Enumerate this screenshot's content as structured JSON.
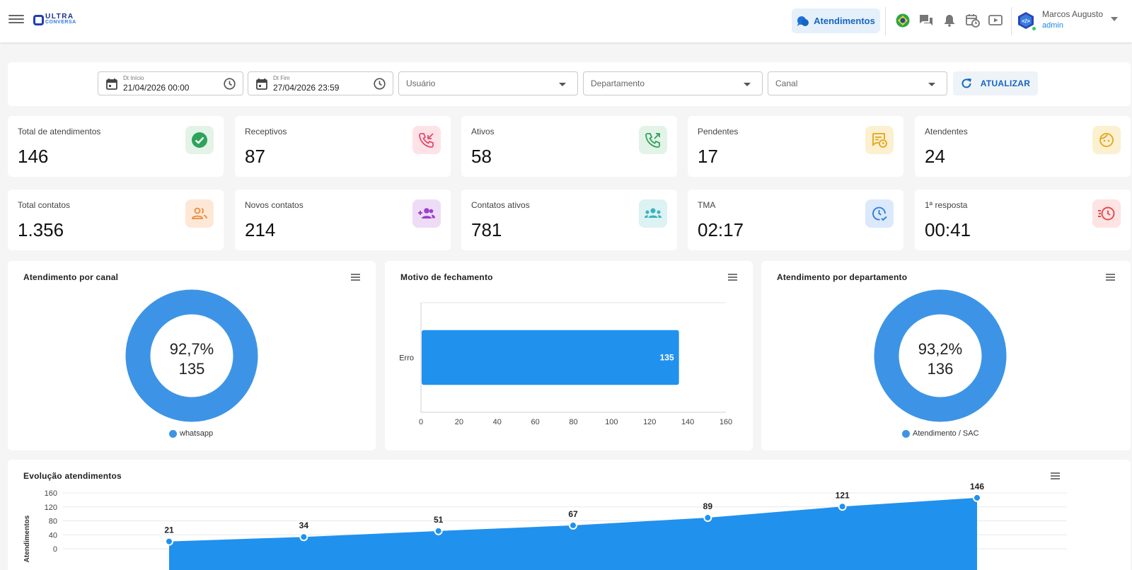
{
  "header": {
    "logo_line1": "ULTRA",
    "logo_line2": "CONVERSA",
    "atendimentos_label": "Atendimentos",
    "user_name": "Marcos Augusto",
    "user_role": "admin"
  },
  "filters": {
    "start_label": "Dt Início",
    "start_value": "21/04/2026 00:00",
    "end_label": "Dt Fim",
    "end_value": "27/04/2026 23:59",
    "user_placeholder": "Usuário",
    "department_placeholder": "Departamento",
    "channel_placeholder": "Canal",
    "refresh_label": "ATUALIZAR"
  },
  "stats": [
    {
      "label": "Total de atendimentos",
      "value": "146",
      "icon": "check-circle-icon",
      "bg": "#e3f3e8",
      "fg": "#2ea35a"
    },
    {
      "label": "Receptivos",
      "value": "87",
      "icon": "incoming-call-icon",
      "bg": "#fde3e8",
      "fg": "#e5486b"
    },
    {
      "label": "Ativos",
      "value": "58",
      "icon": "outgoing-call-icon",
      "bg": "#e3f3e8",
      "fg": "#2ea35a"
    },
    {
      "label": "Pendentes",
      "value": "17",
      "icon": "pending-icon",
      "bg": "#fbf0cf",
      "fg": "#e3a51a"
    },
    {
      "label": "Atendentes",
      "value": "24",
      "icon": "agent-face-icon",
      "bg": "#fbf0cf",
      "fg": "#e3a51a"
    },
    {
      "label": "Total contatos",
      "value": "1.356",
      "icon": "contacts-icon",
      "bg": "#fde8d7",
      "fg": "#ee8a3c"
    },
    {
      "label": "Novos contatos",
      "value": "214",
      "icon": "add-contacts-icon",
      "bg": "#eedcf6",
      "fg": "#9c3fcf"
    },
    {
      "label": "Contatos ativos",
      "value": "781",
      "icon": "group-icon",
      "bg": "#dcf2f3",
      "fg": "#38b3bd"
    },
    {
      "label": "TMA",
      "value": "02:17",
      "icon": "clock-check-icon",
      "bg": "#dbe9fb",
      "fg": "#2f7fe0"
    },
    {
      "label": "1ª resposta",
      "value": "00:41",
      "icon": "fast-timer-icon",
      "bg": "#fde3e3",
      "fg": "#e5484d"
    }
  ],
  "panels": {
    "channel_title": "Atendimento por canal",
    "closing_title": "Motivo de fechamento",
    "department_title": "Atendimento por departamento",
    "evolution_title": "Evolução atendimentos"
  },
  "chart_data": [
    {
      "type": "pie",
      "title": "Atendimento por canal",
      "labels": [
        "whatsapp"
      ],
      "values": [
        135
      ],
      "center_percent": "92,7%",
      "center_value": "135",
      "color": "#3d94e6"
    },
    {
      "type": "bar",
      "orientation": "horizontal",
      "title": "Motivo de fechamento",
      "categories": [
        "Erro"
      ],
      "values": [
        135
      ],
      "xlim": [
        0,
        160
      ],
      "xticks": [
        0,
        20,
        40,
        60,
        80,
        100,
        120,
        140,
        160
      ],
      "color": "#2191ee"
    },
    {
      "type": "pie",
      "title": "Atendimento por departamento",
      "labels": [
        "Atendimento / SAC"
      ],
      "values": [
        136
      ],
      "center_percent": "93,2%",
      "center_value": "136",
      "color": "#3d94e6"
    },
    {
      "type": "area",
      "title": "Evolução atendimentos",
      "ylabel": "Atendimentos",
      "values": [
        21,
        34,
        51,
        67,
        89,
        121,
        146
      ],
      "ylim": [
        0,
        160
      ],
      "yticks": [
        0,
        40,
        80,
        120,
        160
      ],
      "color": "#2191ee"
    }
  ]
}
